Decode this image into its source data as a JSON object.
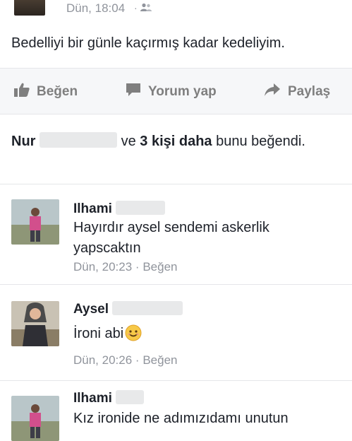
{
  "post": {
    "timestamp": "Dün, 18:04",
    "audience_separator": "·",
    "audience_icon": "friends-icon",
    "text": "Bedelliyi bir günle kaçırmış kadar kedeliyim."
  },
  "actions": {
    "like": "Beğen",
    "comment": "Yorum yap",
    "share": "Paylaş"
  },
  "likes": {
    "name": "Nur",
    "middle": "ve",
    "others": "3 kişi daha",
    "suffix": "bunu beğendi."
  },
  "comments": [
    {
      "author": "Ilhami",
      "text": "Hayırdır aysel sendemi askerlik yapscaktın",
      "time": "Dün, 20:23",
      "sep": "·",
      "like": "Beğen"
    },
    {
      "author": "Aysel",
      "text": "İroni abi",
      "emoji": "smiley-emoji",
      "time": "Dün, 20:26",
      "sep": "·",
      "like": "Beğen"
    },
    {
      "author": "Ilhami",
      "text": "Kız ironide ne adımızıdamı unutun"
    }
  ],
  "colors": {
    "text": "#1d2129",
    "meta": "#90949c",
    "action_bar": "#f6f7f9"
  }
}
